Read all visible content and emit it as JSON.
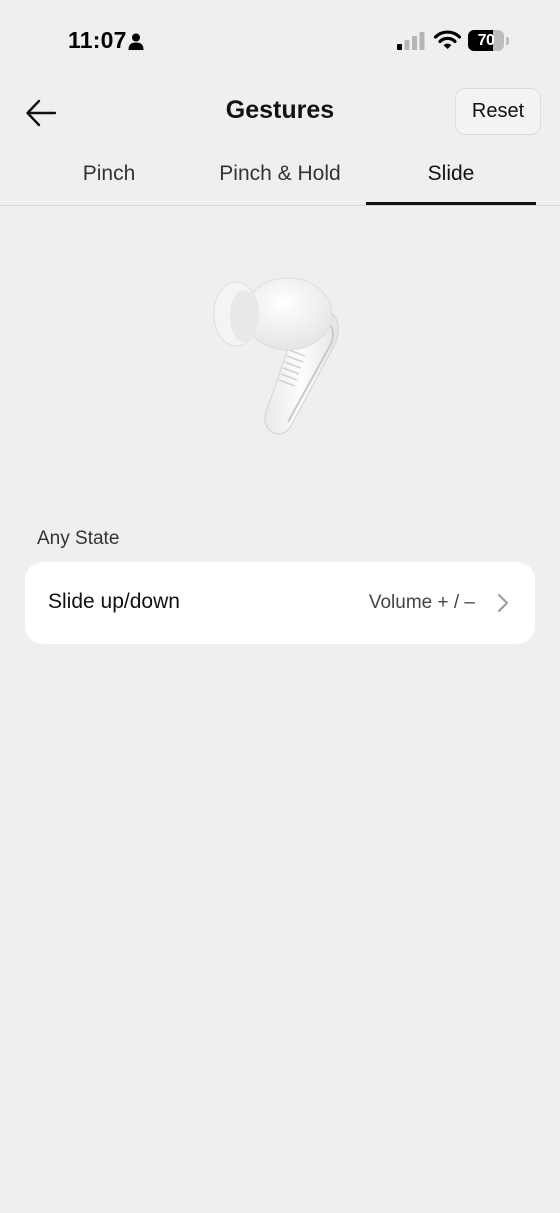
{
  "status_bar": {
    "time": "11:07",
    "battery_level": "70",
    "battery_fraction": 0.7,
    "icons": [
      "person-icon",
      "signal-icon",
      "wifi-icon",
      "battery-icon"
    ]
  },
  "header": {
    "title": "Gestures",
    "back_icon": "back-arrow-icon",
    "reset_label": "Reset"
  },
  "tabs": [
    {
      "label": "Pinch",
      "active": false
    },
    {
      "label": "Pinch & Hold",
      "active": false
    },
    {
      "label": "Slide",
      "active": true
    }
  ],
  "product_image": "earbud-image",
  "section": {
    "label": "Any State",
    "rows": [
      {
        "label": "Slide up/down",
        "value": "Volume + / –",
        "icon": "chevron-right-icon"
      }
    ]
  },
  "colors": {
    "background": "#efefef",
    "card": "#ffffff",
    "text": "#111111",
    "active_tab_indicator": "#111111"
  }
}
